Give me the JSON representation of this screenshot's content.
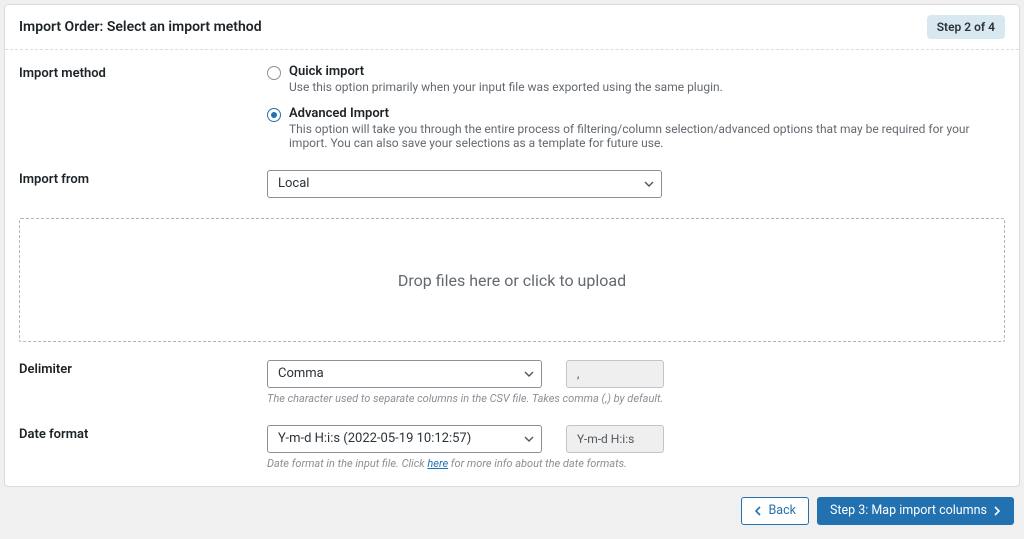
{
  "header": {
    "title": "Import Order: Select an import method",
    "step_badge": "Step 2 of 4"
  },
  "import_method": {
    "label": "Import method",
    "quick": {
      "title": "Quick import",
      "desc": "Use this option primarily when your input file was exported using the same plugin."
    },
    "advanced": {
      "title": "Advanced Import",
      "desc": "This option will take you through the entire process of filtering/column selection/advanced options that may be required for your import. You can also save your selections as a template for future use."
    }
  },
  "import_from": {
    "label": "Import from",
    "value": "Local"
  },
  "dropzone": {
    "text": "Drop files here or click to upload"
  },
  "delimiter": {
    "label": "Delimiter",
    "value": "Comma",
    "preview": ",",
    "helper": "The character used to separate columns in the CSV file. Takes comma (,) by default."
  },
  "date_format": {
    "label": "Date format",
    "value": "Y-m-d H:i:s (2022-05-19 10:12:57)",
    "preview": "Y-m-d H:i:s",
    "helper_prefix": "Date format in the input file. Click ",
    "helper_link": "here",
    "helper_suffix": " for more info about the date formats."
  },
  "footer": {
    "back": "Back",
    "next": "Step 3: Map import columns"
  }
}
